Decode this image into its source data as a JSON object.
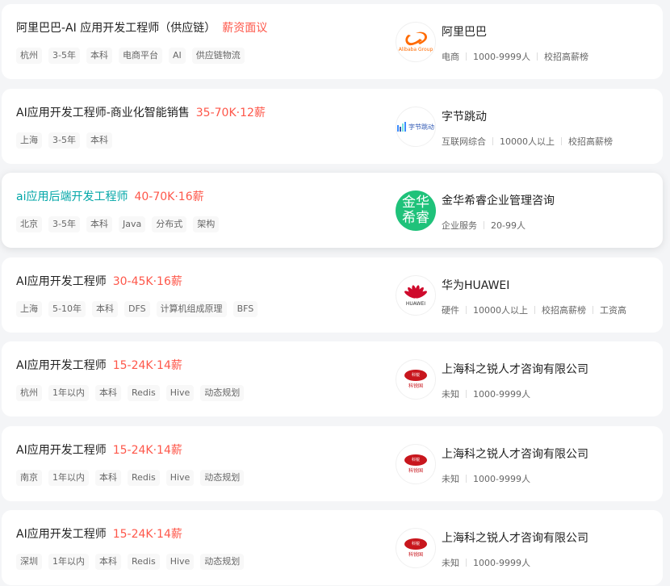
{
  "jobs": [
    {
      "title": "阿里巴巴-AI 应用开发工程师（供应链）",
      "salary": "薪资面议",
      "tags": [
        "杭州",
        "3-5年",
        "本科",
        "电商平台",
        "AI",
        "供应链物流"
      ],
      "company": "阿里巴巴",
      "meta": [
        "电商",
        "1000-9999人",
        "校招高薪榜"
      ],
      "logo": {
        "type": "alibaba",
        "text": "Alibaba Group",
        "icon": "alibaba-logo"
      },
      "hovered": false
    },
    {
      "title": "AI应用开发工程师-商业化智能销售",
      "salary": "35-70K·12薪",
      "tags": [
        "上海",
        "3-5年",
        "本科"
      ],
      "company": "字节跳动",
      "meta": [
        "互联网综合",
        "10000人以上",
        "校招高薪榜"
      ],
      "logo": {
        "type": "bytedance",
        "text": "字节跳动",
        "icon": "bytedance-logo"
      },
      "hovered": false
    },
    {
      "title": "ai应用后端开发工程师",
      "salary": "40-70K·16薪",
      "tags": [
        "北京",
        "3-5年",
        "本科",
        "Java",
        "分布式",
        "架构"
      ],
      "company": "金华希睿企业管理咨询",
      "meta": [
        "企业服务",
        "20-99人"
      ],
      "logo": {
        "type": "green",
        "line1": "金华",
        "line2": "希睿",
        "icon": "jinhua-logo"
      },
      "hovered": true
    },
    {
      "title": "AI应用开发工程师",
      "salary": "30-45K·16薪",
      "tags": [
        "上海",
        "5-10年",
        "本科",
        "DFS",
        "计算机组成原理",
        "BFS"
      ],
      "company": "华为HUAWEI",
      "meta": [
        "硬件",
        "10000人以上",
        "校招高薪榜",
        "工资高"
      ],
      "logo": {
        "type": "huawei",
        "text": "HUAWEI",
        "icon": "huawei-logo"
      },
      "hovered": false
    },
    {
      "title": "AI应用开发工程师",
      "salary": "15-24K·14薪",
      "tags": [
        "杭州",
        "1年以内",
        "本科",
        "Redis",
        "Hive",
        "动态规划"
      ],
      "company": "上海科之锐人才咨询有限公司",
      "meta": [
        "未知",
        "1000-9999人"
      ],
      "logo": {
        "type": "seal",
        "text": "科锐",
        "sub": "科锐国",
        "icon": "careerintl-logo"
      },
      "hovered": false
    },
    {
      "title": "AI应用开发工程师",
      "salary": "15-24K·14薪",
      "tags": [
        "南京",
        "1年以内",
        "本科",
        "Redis",
        "Hive",
        "动态规划"
      ],
      "company": "上海科之锐人才咨询有限公司",
      "meta": [
        "未知",
        "1000-9999人"
      ],
      "logo": {
        "type": "seal",
        "text": "科锐",
        "sub": "科锐国",
        "icon": "careerintl-logo"
      },
      "hovered": false
    },
    {
      "title": "AI应用开发工程师",
      "salary": "15-24K·14薪",
      "tags": [
        "深圳",
        "1年以内",
        "本科",
        "Redis",
        "Hive",
        "动态规划"
      ],
      "company": "上海科之锐人才咨询有限公司",
      "meta": [
        "未知",
        "1000-9999人"
      ],
      "logo": {
        "type": "seal",
        "text": "科锐",
        "sub": "科锐国",
        "icon": "careerintl-logo"
      },
      "hovered": false
    }
  ],
  "colors": {
    "salary": "#fe574a",
    "hover_title": "#00a6a7",
    "text": "#222222",
    "muted": "#666666"
  }
}
